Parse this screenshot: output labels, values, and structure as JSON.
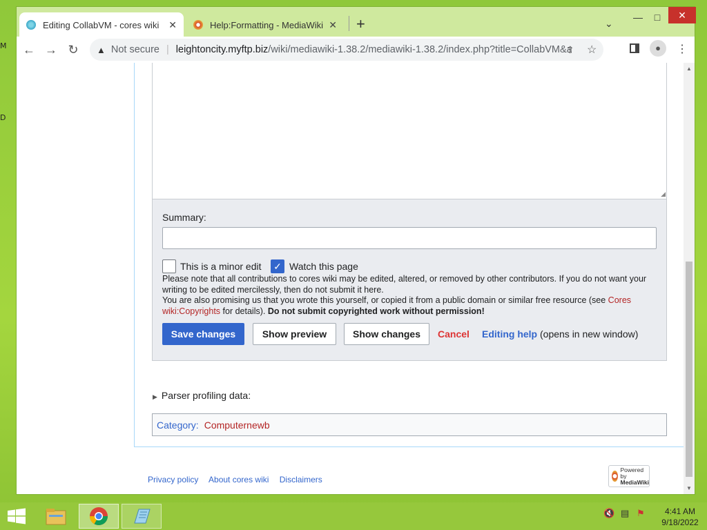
{
  "window": {
    "controls": {
      "minimize": "—",
      "maximize": "□",
      "close": "✕"
    }
  },
  "tabs": [
    {
      "title": "Editing CollabVM - cores wiki",
      "active": true
    },
    {
      "title": "Help:Formatting - MediaWiki",
      "active": false
    }
  ],
  "toolbar": {
    "not_secure": "Not secure",
    "url_host": "leightoncity.myftp.biz",
    "url_path": "/wiki/mediawiki-1.38.2/mediawiki-1.38.2/index.php?title=CollabVM&ac..."
  },
  "edit": {
    "summary_label": "Summary:",
    "summary_value": "",
    "minor_edit_label": "This is a minor edit",
    "watch_label": "Watch this page",
    "minor_edit_checked": false,
    "watch_checked": true,
    "notice1": "Please note that all contributions to cores wiki may be edited, altered, or removed by other contributors. If you do not want your writing to be edited mercilessly, then do not submit it here.",
    "notice2_pre": "You are also promising us that you wrote this yourself, or copied it from a public domain or similar free resource (see ",
    "notice2_link": "Cores wiki:Copyrights",
    "notice2_post": " for details). ",
    "notice2_bold": "Do not submit copyrighted work without permission!",
    "save_label": "Save changes",
    "preview_label": "Show preview",
    "changes_label": "Show changes",
    "cancel_label": "Cancel",
    "help_link": "Editing help",
    "help_suffix": " (opens in new window)"
  },
  "parser_profiling": "Parser profiling data:",
  "category": {
    "label": "Category:",
    "value": "Computernewb"
  },
  "footer": {
    "privacy": "Privacy policy",
    "about": "About cores wiki",
    "disclaimers": "Disclaimers"
  },
  "powered": {
    "line1": "Powered by",
    "line2": "MediaWiki"
  },
  "desktop_letters": [
    "M",
    "D"
  ],
  "clock": {
    "time": "4:41 AM",
    "date": "9/18/2022"
  },
  "colors": {
    "accent": "#3366cc",
    "cancel": "#d33333",
    "desktop": "#9acd3f"
  }
}
